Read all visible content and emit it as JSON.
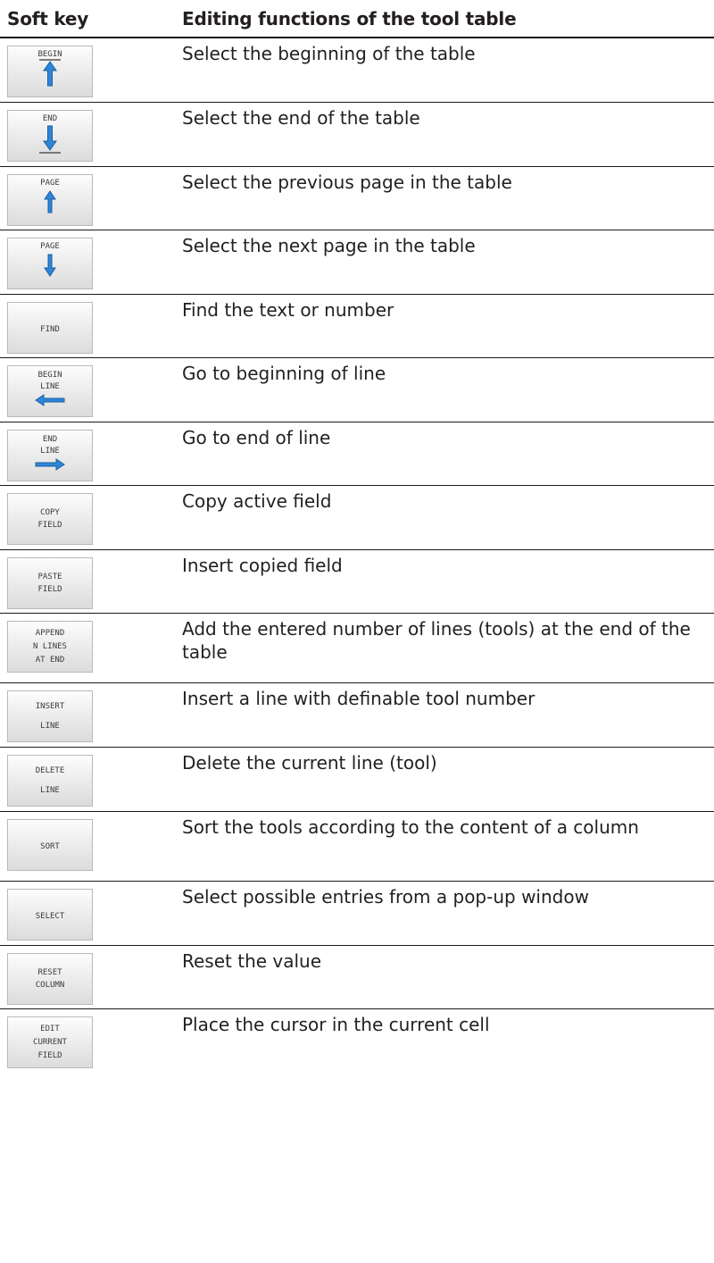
{
  "header": {
    "col1": "Soft key",
    "col2": "Editing functions of the tool table"
  },
  "rows": [
    {
      "key": [
        "BEGIN"
      ],
      "icon": "arrow-to-top-icon",
      "desc": "Select the beginning of the table"
    },
    {
      "key": [
        "END"
      ],
      "icon": "arrow-to-bottom-icon",
      "desc": "Select the end of the table"
    },
    {
      "key": [
        "PAGE"
      ],
      "icon": "arrow-up-icon",
      "desc": "Select the previous page in the table"
    },
    {
      "key": [
        "PAGE"
      ],
      "icon": "arrow-down-icon",
      "desc": "Select the next page in the table"
    },
    {
      "key": [
        "FIND"
      ],
      "desc": "Find the text or number"
    },
    {
      "key": [
        "BEGIN",
        "LINE"
      ],
      "icon": "arrow-left-icon",
      "desc": "Go to beginning of line"
    },
    {
      "key": [
        "END",
        "LINE"
      ],
      "icon": "arrow-right-icon",
      "desc": "Go to end of line"
    },
    {
      "key": [
        "COPY",
        "FIELD"
      ],
      "desc": "Copy active field"
    },
    {
      "key": [
        "PASTE",
        "FIELD"
      ],
      "desc": "Insert copied field"
    },
    {
      "key": [
        "APPEND",
        "N LINES",
        "AT END"
      ],
      "desc": "Add the entered number of lines (tools) at the end of the table"
    },
    {
      "key": [
        "INSERT",
        "LINE"
      ],
      "desc": "Insert a line with definable tool number"
    },
    {
      "key": [
        "DELETE",
        "LINE"
      ],
      "desc": "Delete the current line (tool)"
    },
    {
      "key": [
        "SORT"
      ],
      "desc": "Sort the tools according to the content of a column"
    },
    {
      "key": [
        "SELECT"
      ],
      "desc": "Select possible entries from a pop-up window"
    },
    {
      "key": [
        "RESET",
        "COLUMN"
      ],
      "desc": "Reset the value"
    },
    {
      "key": [
        "EDIT",
        "CURRENT",
        "FIELD"
      ],
      "desc": "Place the cursor in the current cell"
    }
  ]
}
